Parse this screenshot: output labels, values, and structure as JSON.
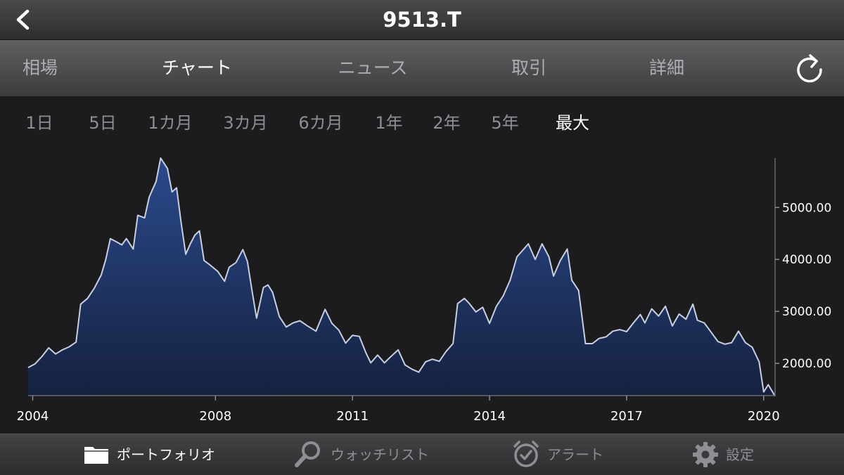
{
  "header": {
    "title": "9513.T"
  },
  "tabs": [
    {
      "label": "相場",
      "active": false
    },
    {
      "label": "チャート",
      "active": true
    },
    {
      "label": "ニュース",
      "active": false
    },
    {
      "label": "取引",
      "active": false
    },
    {
      "label": "詳細",
      "active": false
    }
  ],
  "ranges": [
    {
      "label": "1日",
      "active": false
    },
    {
      "label": "5日",
      "active": false
    },
    {
      "label": "1カ月",
      "active": false
    },
    {
      "label": "3カ月",
      "active": false
    },
    {
      "label": "6カ月",
      "active": false
    },
    {
      "label": "1年",
      "active": false
    },
    {
      "label": "2年",
      "active": false
    },
    {
      "label": "5年",
      "active": false
    },
    {
      "label": "最大",
      "active": true
    }
  ],
  "bottom_nav": [
    {
      "label": "ポートフォリオ",
      "icon": "folder-icon",
      "active": true
    },
    {
      "label": "ウォッチリスト",
      "icon": "magnifier-icon",
      "active": false
    },
    {
      "label": "アラート",
      "icon": "alarm-clock-icon",
      "active": false
    },
    {
      "label": "設定",
      "icon": "gear-icon",
      "active": false
    }
  ],
  "colors": {
    "area_top": "#2b4a8c",
    "area_bottom": "#15213f",
    "line": "#c8cfe0",
    "background": "#1c1c1e"
  },
  "chart_data": {
    "type": "area",
    "x_ticks": [
      "2004",
      "2008",
      "2011",
      "2014",
      "2017",
      "2020"
    ],
    "x_tick_values": [
      2004,
      2008,
      2011,
      2014,
      2017,
      2020
    ],
    "y_ticks": [
      2000,
      3000,
      4000,
      5000
    ],
    "y_tick_labels": [
      "2000.00",
      "3000.00",
      "4000.00",
      "5000.00"
    ],
    "xlim": [
      2003.9,
      2020.25
    ],
    "ylim": [
      1380,
      5950
    ],
    "x": [
      2003.9,
      2004.05,
      2004.2,
      2004.35,
      2004.5,
      2004.65,
      2004.8,
      2004.95,
      2005.05,
      2005.2,
      2005.35,
      2005.5,
      2005.6,
      2005.7,
      2005.85,
      2005.95,
      2006.05,
      2006.2,
      2006.3,
      2006.45,
      2006.55,
      2006.7,
      2006.8,
      2006.95,
      2007.05,
      2007.15,
      2007.25,
      2007.35,
      2007.45,
      2007.55,
      2007.65,
      2007.75,
      2007.9,
      2008.05,
      2008.2,
      2008.3,
      2008.45,
      2008.6,
      2008.7,
      2008.8,
      2008.9,
      2009.05,
      2009.15,
      2009.25,
      2009.4,
      2009.55,
      2009.7,
      2009.85,
      2010.0,
      2010.2,
      2010.4,
      2010.55,
      2010.7,
      2010.85,
      2011.0,
      2011.15,
      2011.3,
      2011.4,
      2011.55,
      2011.7,
      2011.85,
      2012.0,
      2012.15,
      2012.3,
      2012.45,
      2012.6,
      2012.75,
      2012.9,
      2013.05,
      2013.2,
      2013.3,
      2013.45,
      2013.55,
      2013.7,
      2013.85,
      2014.0,
      2014.15,
      2014.3,
      2014.45,
      2014.6,
      2014.75,
      2014.85,
      2015.0,
      2015.15,
      2015.3,
      2015.4,
      2015.55,
      2015.7,
      2015.8,
      2015.95,
      2016.1,
      2016.25,
      2016.4,
      2016.55,
      2016.7,
      2016.85,
      2017.0,
      2017.15,
      2017.3,
      2017.4,
      2017.55,
      2017.7,
      2017.85,
      2018.0,
      2018.15,
      2018.3,
      2018.45,
      2018.55,
      2018.7,
      2018.85,
      2019.0,
      2019.15,
      2019.3,
      2019.45,
      2019.6,
      2019.75,
      2019.9,
      2020.0,
      2020.1,
      2020.25
    ],
    "y": [
      1920,
      1990,
      2130,
      2300,
      2180,
      2260,
      2320,
      2410,
      3140,
      3250,
      3450,
      3700,
      4000,
      4400,
      4330,
      4280,
      4400,
      4200,
      4850,
      4800,
      5200,
      5500,
      5950,
      5750,
      5300,
      5380,
      4700,
      4100,
      4300,
      4470,
      4550,
      3980,
      3880,
      3770,
      3580,
      3850,
      3940,
      4190,
      3960,
      3400,
      2870,
      3460,
      3510,
      3370,
      2900,
      2700,
      2780,
      2820,
      2730,
      2620,
      3040,
      2770,
      2640,
      2390,
      2540,
      2520,
      2190,
      2010,
      2160,
      2010,
      2140,
      2260,
      1970,
      1890,
      1830,
      2030,
      2080,
      2040,
      2230,
      2380,
      3150,
      3250,
      3160,
      2990,
      3080,
      2770,
      3100,
      3300,
      3600,
      4050,
      4200,
      4300,
      4000,
      4300,
      4050,
      3680,
      3980,
      4200,
      3600,
      3400,
      2380,
      2380,
      2480,
      2510,
      2620,
      2650,
      2610,
      2780,
      2940,
      2780,
      3050,
      2910,
      3100,
      2720,
      2950,
      2850,
      3140,
      2830,
      2780,
      2600,
      2420,
      2370,
      2400,
      2620,
      2400,
      2310,
      2030,
      1450,
      1590,
      1370
    ]
  }
}
